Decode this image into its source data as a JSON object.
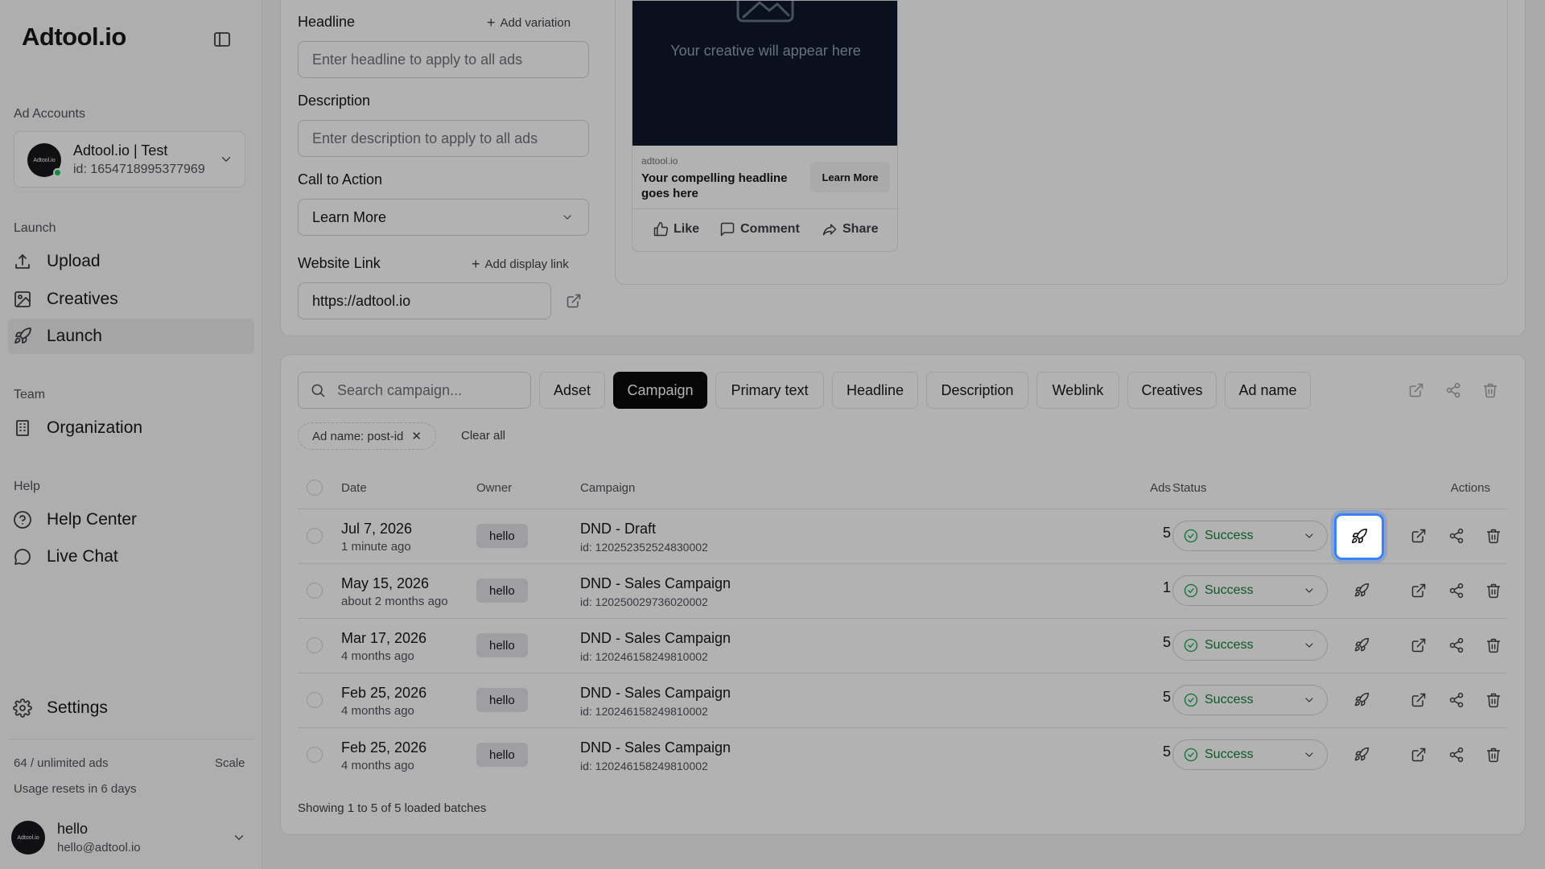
{
  "app": {
    "logo": "Adtool.io"
  },
  "sidebar": {
    "ad_accounts_label": "Ad Accounts",
    "account": {
      "avatar_text": "Adtool.io",
      "name": "Adtool.io | Test",
      "id": "id: 1654718995377969"
    },
    "launch_label": "Launch",
    "launch_items": [
      {
        "label": "Upload",
        "icon": "upload-icon"
      },
      {
        "label": "Creatives",
        "icon": "image-icon"
      },
      {
        "label": "Launch",
        "icon": "rocket-icon",
        "active": true
      }
    ],
    "team_label": "Team",
    "team_items": [
      {
        "label": "Organization",
        "icon": "building-icon"
      }
    ],
    "help_label": "Help",
    "help_items": [
      {
        "label": "Help Center",
        "icon": "help-circle-icon"
      },
      {
        "label": "Live Chat",
        "icon": "chat-icon"
      }
    ],
    "settings_label": "Settings",
    "usage": "64 / unlimited ads",
    "scale": "Scale",
    "resets": "Usage resets in 6 days",
    "user": {
      "avatar_text": "Adtool.io",
      "name": "hello",
      "email": "hello@adtool.io"
    }
  },
  "form": {
    "headline_label": "Headline",
    "add_variation": "Add variation",
    "headline_placeholder": "Enter headline to apply to all ads",
    "description_label": "Description",
    "description_placeholder": "Enter description to apply to all ads",
    "cta_label": "Call to Action",
    "cta_value": "Learn More",
    "website_label": "Website Link",
    "add_display_link": "Add display link",
    "website_value": "https://adtool.io"
  },
  "preview": {
    "placeholder": "Your creative will appear here",
    "domain": "adtool.io",
    "headline": "Your compelling headline goes here",
    "cta": "Learn More",
    "like": "Like",
    "comment": "Comment",
    "share": "Share"
  },
  "filters": {
    "search_placeholder": "Search campaign...",
    "tabs": [
      "Adset",
      "Campaign",
      "Primary text",
      "Headline",
      "Description",
      "Weblink",
      "Creatives",
      "Ad name"
    ],
    "active_tab": "Campaign",
    "chip": "Ad name: post-id",
    "clear_all": "Clear all"
  },
  "table": {
    "headers": {
      "date": "Date",
      "owner": "Owner",
      "campaign": "Campaign",
      "ads": "Ads",
      "status": "Status",
      "actions": "Actions"
    },
    "rows": [
      {
        "date": "Jul 7, 2026",
        "ago": "1 minute ago",
        "owner": "hello",
        "campaign": "DND - Draft",
        "id": "id: 120252352524830002",
        "ads": "5",
        "status": "Success"
      },
      {
        "date": "May 15, 2026",
        "ago": "about 2 months ago",
        "owner": "hello",
        "campaign": "DND - Sales Campaign",
        "id": "id: 120250029736020002",
        "ads": "1",
        "status": "Success"
      },
      {
        "date": "Mar 17, 2026",
        "ago": "4 months ago",
        "owner": "hello",
        "campaign": "DND - Sales Campaign",
        "id": "id: 120246158249810002",
        "ads": "5",
        "status": "Success"
      },
      {
        "date": "Feb 25, 2026",
        "ago": "4 months ago",
        "owner": "hello",
        "campaign": "DND - Sales Campaign",
        "id": "id: 120246158249810002",
        "ads": "5",
        "status": "Success"
      },
      {
        "date": "Feb 25, 2026",
        "ago": "4 months ago",
        "owner": "hello",
        "campaign": "DND - Sales Campaign",
        "id": "id: 120246158249810002",
        "ads": "5",
        "status": "Success"
      }
    ],
    "showing": "Showing 1 to 5 of 5 loaded batches"
  },
  "colors": {
    "focus_ring": "#3b82f6",
    "success": "#15803d",
    "active_tab": "#0a0a0a"
  }
}
